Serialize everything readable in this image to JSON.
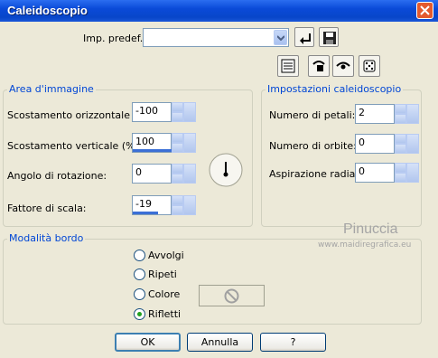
{
  "window": {
    "title": "Caleidoscopio"
  },
  "preset": {
    "label": "Imp. predef.:",
    "value": ""
  },
  "area": {
    "legend": "Area d'immagine",
    "fields": [
      {
        "label": "Scostamento orizzontale (%):",
        "value": "-100",
        "level": 0
      },
      {
        "label": "Scostamento verticale (%):",
        "value": "100",
        "level": 1.0
      },
      {
        "label": "Angolo di rotazione:",
        "value": "0",
        "level": 0
      },
      {
        "label": "Fattore di scala:",
        "value": "-19",
        "level": 0.4
      }
    ]
  },
  "kaleido": {
    "legend": "Impostazioni caleidoscopio",
    "fields": [
      {
        "label": "Numero di petali:",
        "value": "2"
      },
      {
        "label": "Numero di orbite:",
        "value": "0"
      },
      {
        "label": "Aspirazione radiale:",
        "value": "0"
      }
    ]
  },
  "border": {
    "legend": "Modalità bordo",
    "options": [
      "Avvolgi",
      "Ripeti",
      "Colore",
      "Rifletti"
    ],
    "selected": "Rifletti"
  },
  "watermark": {
    "name": "Pinuccia",
    "site": "www.maidiregrafica.eu"
  },
  "buttons": {
    "ok": "OK",
    "cancel": "Annulla",
    "help": "?"
  },
  "colors": {
    "titlebar": "#0a4ad8",
    "legend": "#0046d5",
    "dialog_bg": "#ece9d8",
    "radio_selected": "#21a121"
  }
}
